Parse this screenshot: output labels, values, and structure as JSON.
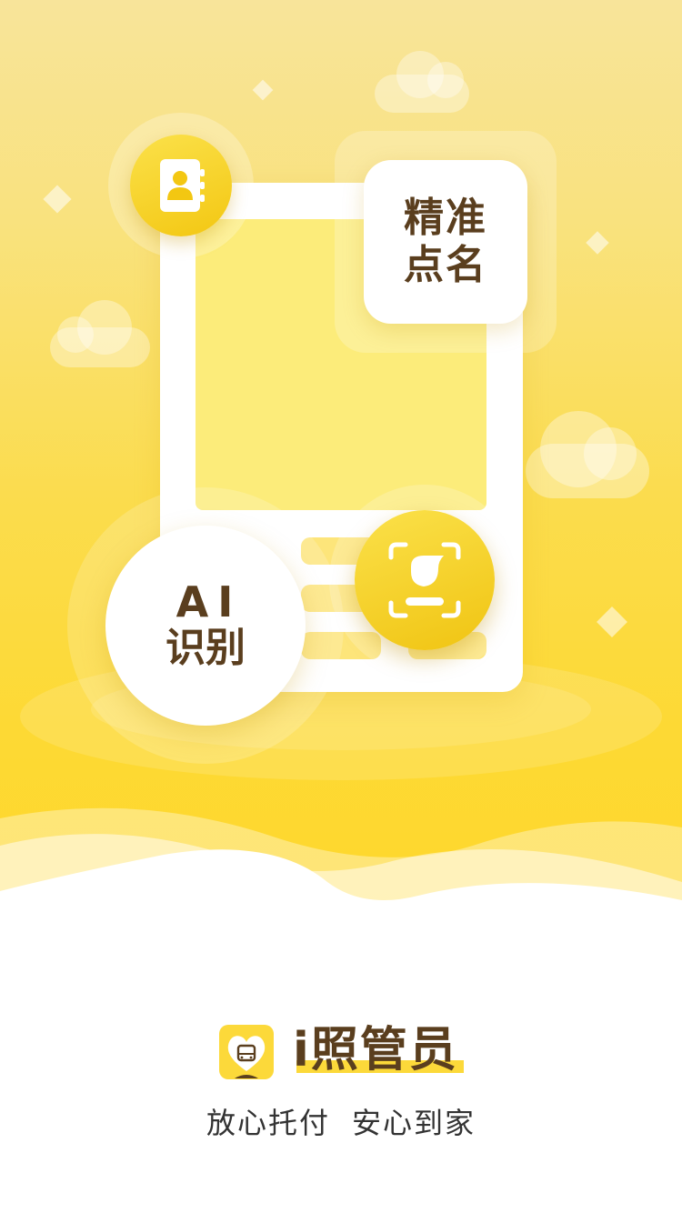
{
  "hero": {
    "tag_precise": "精准点名",
    "tag_ai_line1": "AI",
    "tag_ai_line2": "识别",
    "icons": [
      "contact-book-icon",
      "face-scan-icon"
    ]
  },
  "brand": {
    "logo_icon": "app-logo-icon",
    "app_name": "i照管员",
    "slogan_part1": "放心托付",
    "slogan_part2": "安心到家"
  },
  "colors": {
    "accent": "#fed82c",
    "text_brown": "#5a3e1e",
    "badge_yellow": "#f3c712"
  }
}
